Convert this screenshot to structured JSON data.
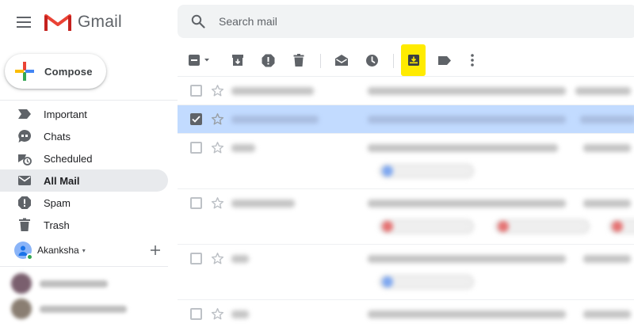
{
  "app": {
    "name": "Gmail",
    "colors": {
      "accent": "#ea4335",
      "blue": "#4285f4",
      "green": "#34a853",
      "yellow": "#fbbc04",
      "highlight": "#ffeb00",
      "selected_row": "#c2dbff"
    }
  },
  "header": {
    "menu_icon": "hamburger-menu-icon",
    "search": {
      "placeholder": "Search mail",
      "icon": "search-icon"
    }
  },
  "compose": {
    "label": "Compose",
    "icon": "plus-icon"
  },
  "sidebar": {
    "items": [
      {
        "label": "Important",
        "icon": "important-icon",
        "active": false
      },
      {
        "label": "Chats",
        "icon": "chat-icon",
        "active": false
      },
      {
        "label": "Scheduled",
        "icon": "scheduled-icon",
        "active": false
      },
      {
        "label": "All Mail",
        "icon": "mail-icon",
        "active": true
      },
      {
        "label": "Spam",
        "icon": "spam-icon",
        "active": false
      },
      {
        "label": "Trash",
        "icon": "trash-icon",
        "active": false
      }
    ]
  },
  "account": {
    "name": "Akanksha",
    "caret": "▾",
    "add_label": "+"
  },
  "toolbar": {
    "buttons": [
      {
        "icon": "select-checkbox-icon",
        "highlighted": false
      },
      {
        "icon": "archive-icon",
        "highlighted": false
      },
      {
        "icon": "report-spam-icon",
        "highlighted": false
      },
      {
        "icon": "delete-icon",
        "highlighted": false
      },
      {
        "icon": "mark-as-read-icon",
        "highlighted": false
      },
      {
        "icon": "snooze-icon",
        "highlighted": false
      },
      {
        "icon": "move-to-inbox-icon",
        "highlighted": true
      },
      {
        "icon": "label-icon",
        "highlighted": false
      },
      {
        "icon": "more-vert-icon",
        "highlighted": false
      }
    ]
  },
  "email_list": {
    "rows": [
      {
        "selected": false,
        "checked": false,
        "starred": false
      },
      {
        "selected": true,
        "checked": true,
        "starred": false
      },
      {
        "selected": false,
        "checked": false,
        "starred": false
      },
      {
        "selected": false,
        "checked": false,
        "starred": false
      },
      {
        "selected": false,
        "checked": false,
        "starred": false
      },
      {
        "selected": false,
        "checked": false,
        "starred": false
      }
    ]
  }
}
